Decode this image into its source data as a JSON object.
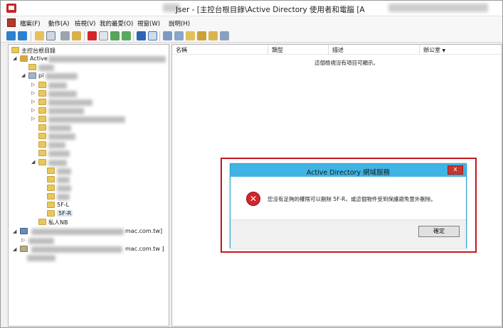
{
  "window": {
    "title": "User - [主控台根目錄\\Active Directory 使用者和電腦 [A",
    "title_prefix_visible": "Jser - [主控台根目錄\\Active Directory 使用者和電腦 [A"
  },
  "menu": {
    "items": [
      "檔案(F)",
      "動作(A)",
      "檢視(V)",
      "我的最愛(O)",
      "視窗(W)",
      "說明(H)"
    ]
  },
  "tree": {
    "root_label": "主控台根目錄",
    "ad_label": "Active",
    "domain_prefix": "pl",
    "ou_5f_l": "5F-L",
    "ou_5f_r": "5F-R",
    "private_nb": "私人NB",
    "domain2_suffix": "mac.com.tw]",
    "domain3_suffix": "mac.com.tw ]"
  },
  "list": {
    "columns": [
      "名稱",
      "類型",
      "描述",
      "辦公室"
    ],
    "empty_message": "這個檢視沒有項目可顯示。"
  },
  "dialog": {
    "title": "Active Directory 網域服務",
    "message": "您沒有足夠的權限可以刪除 5F-R，或這個物件受到保護避免意外刪除。",
    "ok_label": "確定",
    "close_glyph": "x",
    "error_glyph": "✕"
  },
  "colors": {
    "highlight": "#c4161c",
    "dialog_title_bar": "#3fb4e5",
    "error_icon": "#d3262c"
  }
}
